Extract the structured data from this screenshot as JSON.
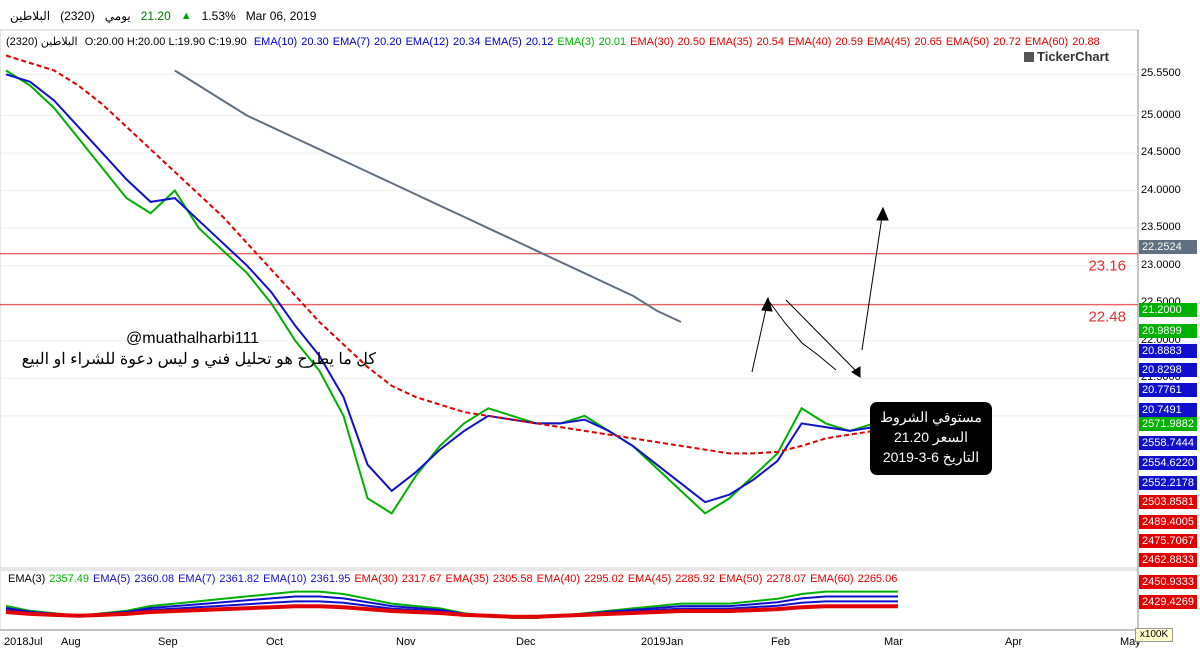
{
  "topbar": {
    "name": "البلاطين",
    "code": "(2320)",
    "period": "يومي",
    "last_price": "21.20",
    "change_pct": "1.53%",
    "date": "Mar 06, 2019"
  },
  "info": {
    "symbol": "البلاطين (2320)",
    "ohlc": "O:20.00 H:20.00 L:19.90 C:19.90",
    "emas": [
      {
        "label": "EMA(10)",
        "value": "20.30",
        "color": "#0000cc"
      },
      {
        "label": "EMA(7)",
        "value": "20.20",
        "color": "#0000cc"
      },
      {
        "label": "EMA(12)",
        "value": "20.34",
        "color": "#0000cc"
      },
      {
        "label": "EMA(5)",
        "value": "20.12",
        "color": "#0000cc"
      },
      {
        "label": "EMA(3)",
        "value": "20.01",
        "color": "#00b000"
      },
      {
        "label": "EMA(30)",
        "value": "20.50",
        "color": "#e00000"
      },
      {
        "label": "EMA(35)",
        "value": "20.54",
        "color": "#e00000"
      },
      {
        "label": "EMA(40)",
        "value": "20.59",
        "color": "#e00000"
      },
      {
        "label": "EMA(45)",
        "value": "20.65",
        "color": "#e00000"
      },
      {
        "label": "EMA(50)",
        "value": "20.72",
        "color": "#e00000"
      },
      {
        "label": "EMA(60)",
        "value": "20.88",
        "color": "#e00000"
      }
    ]
  },
  "logo": "TickerChart",
  "annotations": {
    "author": "@muathalharbi111",
    "disclaimer": "كل ما يطرح هو تحليل فني  و ليس دعوة للشراء او البيع",
    "note_line1": "مستوفي الشروط",
    "note_line2": "السعر 21.20",
    "note_line3": "التاريخ 6-3-2019"
  },
  "chart_data": [
    {
      "type": "line",
      "title": "",
      "y_axis_ticks": [
        "25.5500",
        "25.0000",
        "24.5000",
        "24.0000",
        "23.5000",
        "23.0000",
        "22.5000",
        "22.0000",
        "21.5000",
        "21.0000"
      ],
      "ylim": [
        19.0,
        25.9
      ],
      "x_labels": [
        "2018Jul",
        "Aug",
        "Sep",
        "Oct",
        "Nov",
        "Dec",
        "2019Jan",
        "Feb",
        "Mar",
        "Apr",
        "May"
      ],
      "horizontal_lines": [
        {
          "value": 23.16,
          "label": "23.16",
          "color": "#e03030"
        },
        {
          "value": 22.48,
          "label": "22.48",
          "color": "#e03030"
        }
      ],
      "price_tags": [
        {
          "value": "22.2524",
          "bg": "#607080"
        },
        {
          "value": "21.2000",
          "bg": "#00b000"
        },
        {
          "value": "20.9899",
          "bg": "#00b000"
        },
        {
          "value": "20.8883",
          "bg": "#1010cc"
        },
        {
          "value": "20.8298",
          "bg": "#1010cc"
        },
        {
          "value": "20.7761",
          "bg": "#1010cc"
        },
        {
          "value": "20.7491",
          "bg": "#1010cc"
        }
      ],
      "series": [
        {
          "name": "EMA(3)",
          "color": "#00b000",
          "values": [
            25.6,
            25.4,
            25.1,
            24.7,
            24.3,
            23.9,
            23.7,
            24.0,
            23.5,
            23.2,
            22.9,
            22.5,
            22.0,
            21.6,
            21.0,
            19.9,
            19.7,
            20.2,
            20.6,
            20.9,
            21.1,
            21.0,
            20.9,
            20.9,
            21.0,
            20.8,
            20.6,
            20.3,
            20.0,
            19.7,
            19.9,
            20.2,
            20.5,
            21.1,
            20.9,
            20.8,
            20.9,
            21.1
          ]
        },
        {
          "name": "EMA(5)",
          "color": "#1010cc",
          "values": [
            25.55,
            25.45,
            25.2,
            24.85,
            24.5,
            24.15,
            23.85,
            23.9,
            23.6,
            23.3,
            23.0,
            22.65,
            22.2,
            21.8,
            21.25,
            20.35,
            20.0,
            20.25,
            20.55,
            20.8,
            21.0,
            20.95,
            20.9,
            20.9,
            20.95,
            20.8,
            20.6,
            20.35,
            20.1,
            19.85,
            19.95,
            20.15,
            20.4,
            20.9,
            20.85,
            20.8,
            20.85,
            20.99
          ]
        },
        {
          "name": "EMA(200)",
          "color": "#607080",
          "values": [
            null,
            null,
            null,
            null,
            null,
            null,
            null,
            25.6,
            25.4,
            25.2,
            25.0,
            24.85,
            24.7,
            24.55,
            24.4,
            24.25,
            24.1,
            23.95,
            23.8,
            23.65,
            23.5,
            23.35,
            23.2,
            23.05,
            22.9,
            22.75,
            22.6,
            22.4,
            22.25
          ]
        },
        {
          "name": "EMA(60)",
          "color": "#e00000",
          "values": [
            25.8,
            25.7,
            25.6,
            25.4,
            25.15,
            24.85,
            24.55,
            24.25,
            23.95,
            23.65,
            23.3,
            22.95,
            22.6,
            22.25,
            21.95,
            21.65,
            21.4,
            21.25,
            21.15,
            21.05,
            21.0,
            20.95,
            20.9,
            20.85,
            20.8,
            20.75,
            20.7,
            20.65,
            20.6,
            20.55,
            20.5,
            20.5,
            20.52,
            20.6,
            20.7,
            20.75,
            20.8,
            20.88
          ]
        }
      ]
    },
    {
      "type": "line",
      "title": "",
      "legend": [
        {
          "label": "EMA(3)",
          "value": "2357.49",
          "color": "#00b000"
        },
        {
          "label": "EMA(5)",
          "value": "2360.08",
          "color": "#1010cc"
        },
        {
          "label": "EMA(7)",
          "value": "2361.82",
          "color": "#1010cc"
        },
        {
          "label": "EMA(10)",
          "value": "2361.95",
          "color": "#1010cc"
        },
        {
          "label": "EMA(30)",
          "value": "2317.67",
          "color": "#e00000"
        },
        {
          "label": "EMA(35)",
          "value": "2305.58",
          "color": "#e00000"
        },
        {
          "label": "EMA(40)",
          "value": "2295.02",
          "color": "#e00000"
        },
        {
          "label": "EMA(45)",
          "value": "2285.92",
          "color": "#e00000"
        },
        {
          "label": "EMA(50)",
          "value": "2278.07",
          "color": "#e00000"
        },
        {
          "label": "EMA(60)",
          "value": "2265.06",
          "color": "#e00000"
        }
      ],
      "value_tags": [
        {
          "value": "2571.9882",
          "bg": "#00b000"
        },
        {
          "value": "2558.7444",
          "bg": "#1010cc"
        },
        {
          "value": "2554.6220",
          "bg": "#1010cc"
        },
        {
          "value": "2552.2178",
          "bg": "#1010cc"
        },
        {
          "value": "2503.8581",
          "bg": "#e00000"
        },
        {
          "value": "2489.4005",
          "bg": "#e00000"
        },
        {
          "value": "2475.7067",
          "bg": "#e00000"
        },
        {
          "value": "2462.8833",
          "bg": "#e00000"
        },
        {
          "value": "2450.9333",
          "bg": "#e00000"
        },
        {
          "value": "2429.4269",
          "bg": "#e00000"
        }
      ],
      "unit_badge": "x100K"
    }
  ]
}
